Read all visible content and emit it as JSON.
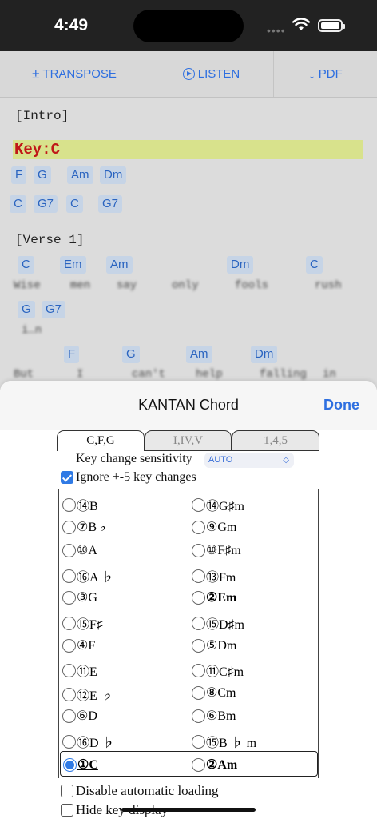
{
  "status": {
    "time": "4:49"
  },
  "toolbar": {
    "transpose": "TRANSPOSE",
    "listen": "LISTEN",
    "pdf": "PDF"
  },
  "sheet": {
    "intro": "[Intro]",
    "key": "Key:C",
    "row1": [
      "F",
      "G",
      "Am",
      "Dm"
    ],
    "row2": [
      "C",
      "G7",
      "C",
      "G7"
    ],
    "verse": "[Verse 1]",
    "row3": [
      "C",
      "Em",
      "Am",
      "Dm",
      "C"
    ],
    "lyrics1": [
      "Wise",
      "men",
      "say",
      "only",
      "fools",
      "rush"
    ],
    "row4": [
      "G",
      "G7"
    ],
    "lyrics2": [
      "i…n"
    ],
    "row5": [
      "F",
      "G",
      "Am",
      "Dm"
    ],
    "lyrics3": [
      "But",
      "I",
      "can't",
      "help",
      "falling",
      "in"
    ]
  },
  "panel": {
    "title": "KANTAN Chord",
    "done": "Done",
    "tabs": [
      "C,F,G",
      "I,IV,V",
      "1,4,5"
    ],
    "sensitivity_label": "Key change sensitivity",
    "sensitivity_value": "AUTO",
    "ignore_label": "Ignore +-5 key changes",
    "keys": [
      [
        "⑭B",
        "⑭G♯m"
      ],
      [
        "⑦B ♭",
        "⑨Gm"
      ],
      [
        "⑩A",
        "⑩F♯m"
      ],
      [
        "⑯A ♭",
        "⑬Fm"
      ],
      [
        "③G",
        "②Em"
      ],
      [
        "⑮F♯",
        "⑮D♯m"
      ],
      [
        "④F",
        "⑤Dm"
      ],
      [
        "⑪E",
        "⑪C♯m"
      ],
      [
        "⑫E ♭",
        "⑧Cm"
      ],
      [
        "⑥D",
        "⑥Bm"
      ],
      [
        "⑯D ♭",
        "⑮B ♭ m"
      ],
      [
        "①C",
        "②Am"
      ]
    ],
    "disable_loading": "Disable automatic loading",
    "hide_key": "Hide key display"
  }
}
